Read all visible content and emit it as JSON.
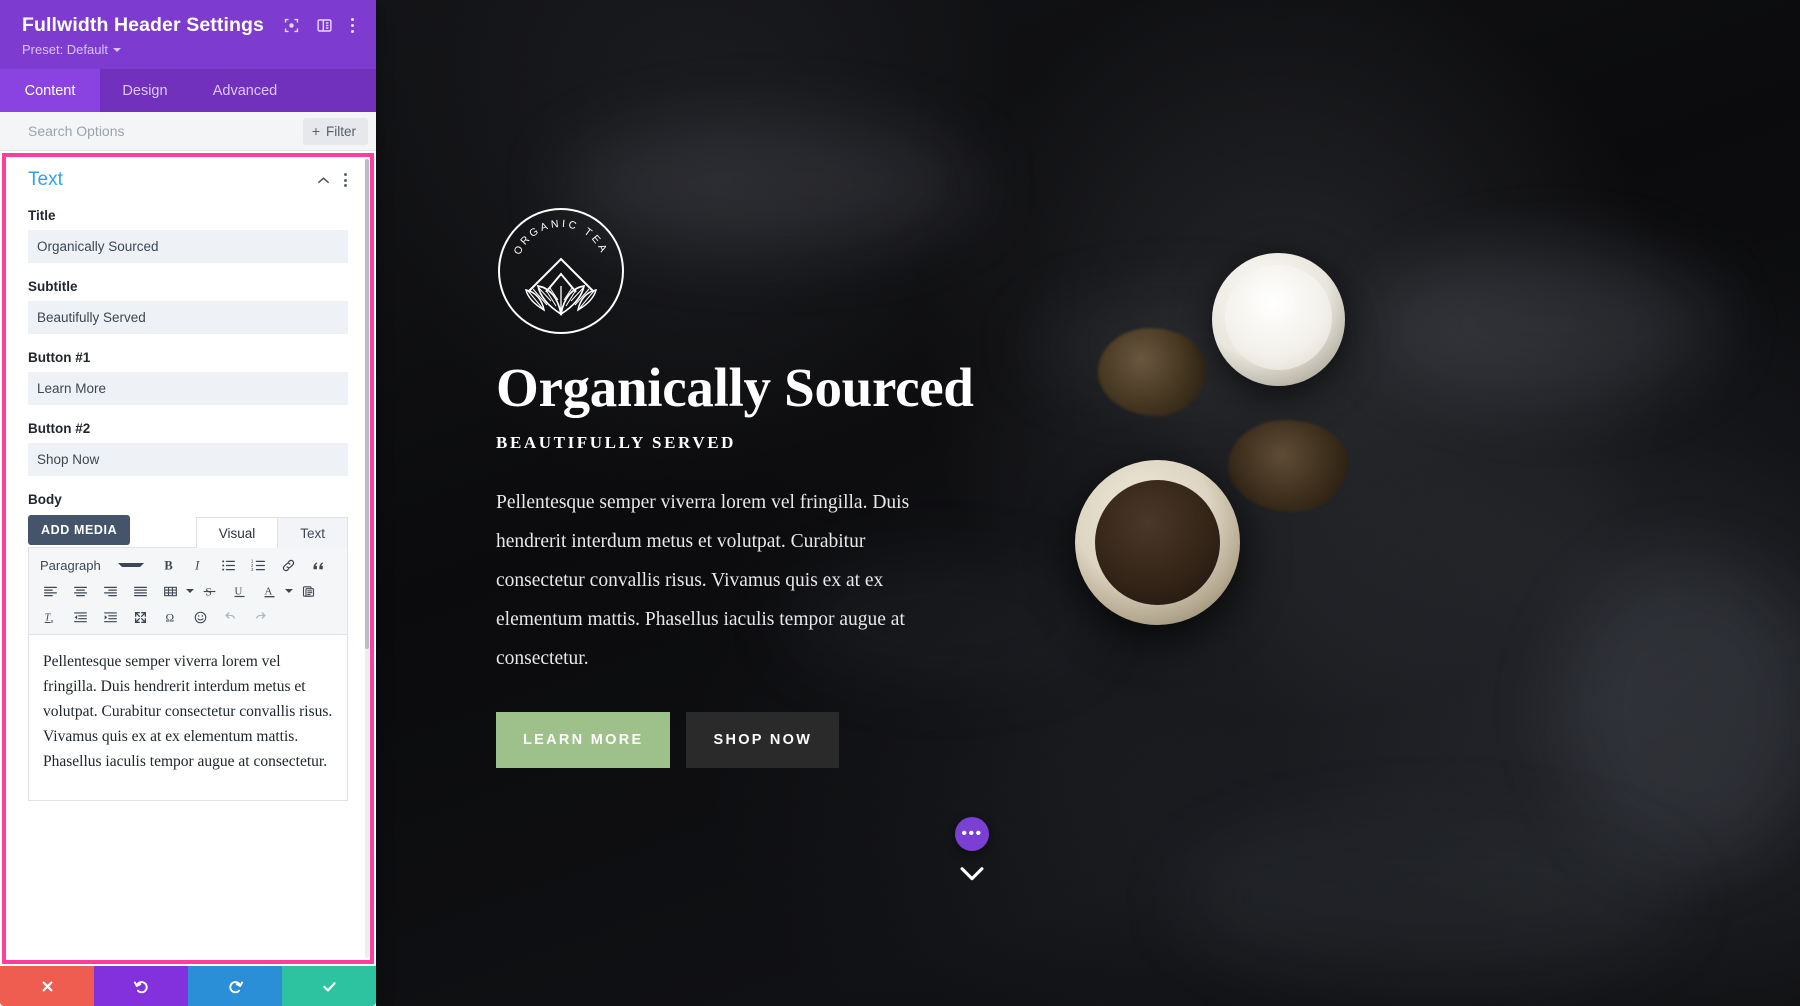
{
  "panel": {
    "title": "Fullwidth Header Settings",
    "preset_label": "Preset: Default",
    "header_icons": [
      {
        "name": "focus-target-icon"
      },
      {
        "name": "layout-columns-icon"
      },
      {
        "name": "kebab-menu-icon"
      }
    ],
    "tabs": [
      {
        "label": "Content",
        "active": true
      },
      {
        "label": "Design",
        "active": false
      },
      {
        "label": "Advanced",
        "active": false
      }
    ],
    "search": {
      "placeholder": "Search Options",
      "value": ""
    },
    "filter_button": {
      "label": "Filter",
      "icon": "plus-icon"
    },
    "section": {
      "title": "Text",
      "collapse_icon": "chevron-up-icon",
      "menu_icon": "kebab-menu-icon"
    },
    "fields": [
      {
        "label": "Title",
        "value": "Organically Sourced",
        "name": "title-field"
      },
      {
        "label": "Subtitle",
        "value": "Beautifully Served",
        "name": "subtitle-field"
      },
      {
        "label": "Button #1",
        "value": "Learn More",
        "name": "button1-field"
      },
      {
        "label": "Button #2",
        "value": "Shop Now",
        "name": "button2-field"
      }
    ],
    "body_field": {
      "label": "Body",
      "add_media_label": "ADD MEDIA",
      "editor_tabs": [
        {
          "label": "Visual",
          "active": true
        },
        {
          "label": "Text",
          "active": false
        }
      ],
      "format_select": "Paragraph",
      "toolbar_rows": [
        [
          "bold-icon",
          "italic-icon",
          "bulleted-list-icon",
          "numbered-list-icon",
          "link-icon",
          "blockquote-icon"
        ],
        [
          "align-left-icon",
          "align-center-icon",
          "align-right-icon",
          "align-justify-icon",
          "table-icon",
          "strikethrough-icon",
          "underline-icon",
          "text-color-icon",
          "paste-icon"
        ],
        [
          "clear-formatting-icon",
          "outdent-icon",
          "indent-icon",
          "fullscreen-icon",
          "special-character-icon",
          "emoji-icon",
          "undo-icon",
          "redo-icon"
        ]
      ],
      "content": "Pellentesque semper viverra lorem vel fringilla. Duis hendrerit interdum metus et volutpat. Curabitur consectetur convallis risus. Vivamus quis ex at ex elementum mattis. Phasellus iaculis tempor augue at consectetur."
    },
    "actions": [
      {
        "name": "discard-button",
        "icon": "close-icon",
        "color": "#ef5d51"
      },
      {
        "name": "undo-button",
        "icon": "undo-icon",
        "color": "#8330dd"
      },
      {
        "name": "redo-button",
        "icon": "redo-icon",
        "color": "#2a8fd6"
      },
      {
        "name": "save-button",
        "icon": "check-icon",
        "color": "#2ec3a0"
      }
    ],
    "highlight_color": "#ff3d9a",
    "accent_color": "#7d3ccf"
  },
  "preview": {
    "logo": {
      "text": "ORGANIC TEA",
      "emblem": "mountain-leaves-icon"
    },
    "title": "Organically Sourced",
    "subtitle": "BEAUTIFULLY SERVED",
    "body": "Pellentesque semper viverra lorem vel fringilla. Duis hendrerit interdum metus et volutpat. Curabitur consectetur convallis risus. Vivamus quis ex at ex elementum mattis. Phasellus iaculis tempor augue at consectetur.",
    "buttons": [
      {
        "label": "LEARN MORE",
        "style": "primary",
        "color": "#9ec08a"
      },
      {
        "label": "SHOP NOW",
        "style": "secondary",
        "color": "#2a2a2a"
      }
    ],
    "fab": {
      "name": "page-settings-fab",
      "glyph": "•••",
      "color": "#7b3fd4"
    },
    "scroll_hint": "chevron-down-icon"
  }
}
